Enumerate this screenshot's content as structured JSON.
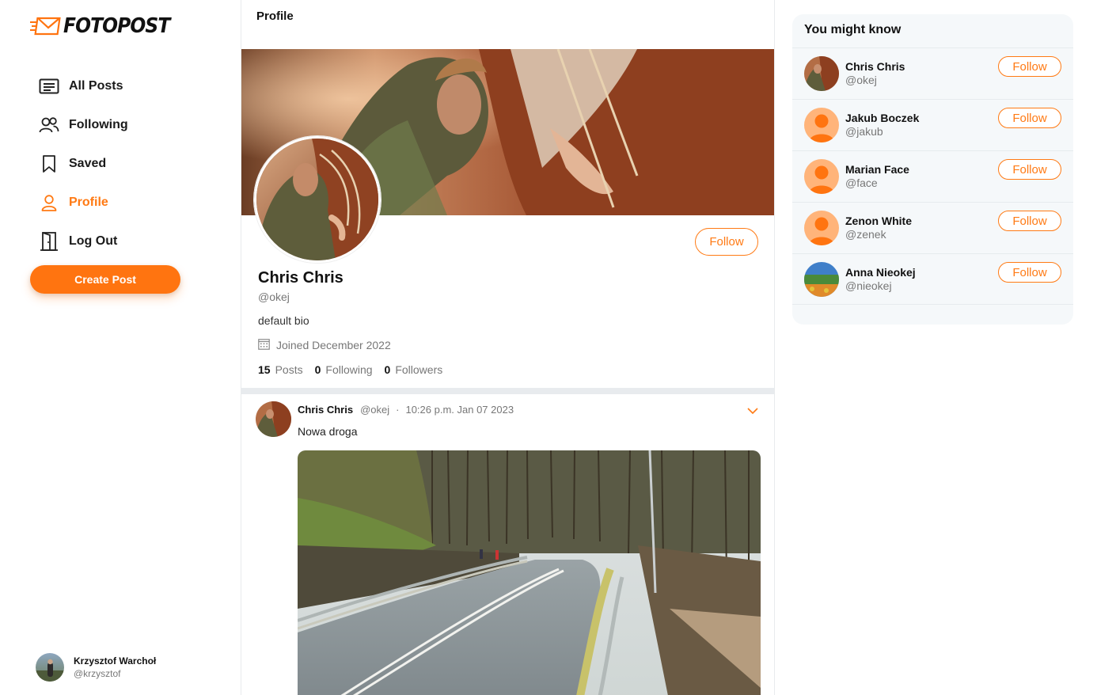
{
  "app": {
    "logo_text": "FOTOPOST"
  },
  "colors": {
    "accent": "#ff7410",
    "muted_text": "#777777",
    "panel_bg": "#f5f8fa"
  },
  "sidebar": {
    "items": [
      {
        "label": "All Posts",
        "icon": "posts-list-icon",
        "active": false
      },
      {
        "label": "Following",
        "icon": "users-icon",
        "active": false
      },
      {
        "label": "Saved",
        "icon": "bookmark-icon",
        "active": false
      },
      {
        "label": "Profile",
        "icon": "user-icon",
        "active": true
      },
      {
        "label": "Log Out",
        "icon": "door-exit-icon",
        "active": false
      }
    ],
    "create_post_label": "Create Post",
    "current_user": {
      "name": "Krzysztof Warchoł",
      "handle": "@krzysztof"
    }
  },
  "main": {
    "header_title": "Profile",
    "profile": {
      "name": "Chris Chris",
      "handle": "@okej",
      "bio": "default bio",
      "joined": "Joined December 2022",
      "follow_label": "Follow",
      "stats": {
        "posts_count": "15",
        "posts_label": "Posts",
        "following_count": "0",
        "following_label": "Following",
        "followers_count": "0",
        "followers_label": "Followers"
      }
    },
    "post": {
      "author": "Chris Chris",
      "handle": "@okej",
      "separator": "·",
      "time": "10:26 p.m. Jan 07 2023",
      "text": "Nowa droga"
    }
  },
  "suggestions": {
    "title": "You might know",
    "follow_label": "Follow",
    "users": [
      {
        "name": "Chris Chris",
        "handle": "@okej",
        "avatar": "photo-horse"
      },
      {
        "name": "Jakub Boczek",
        "handle": "@jakub",
        "avatar": "default-user"
      },
      {
        "name": "Marian Face",
        "handle": "@face",
        "avatar": "default-user"
      },
      {
        "name": "Zenon White",
        "handle": "@zenek",
        "avatar": "default-user"
      },
      {
        "name": "Anna Nieokej",
        "handle": "@nieokej",
        "avatar": "photo-landscape"
      }
    ]
  }
}
